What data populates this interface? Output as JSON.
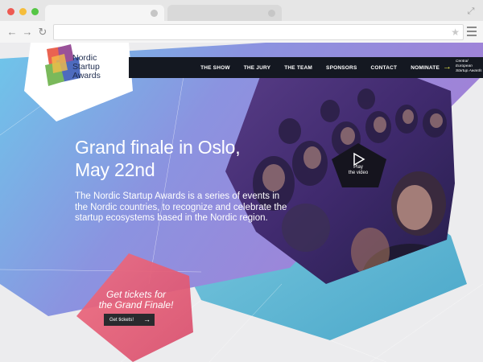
{
  "browser": {
    "icons": {
      "back": "back-arrow-icon",
      "forward": "forward-arrow-icon",
      "reload": "reload-icon",
      "bookmark": "star-icon",
      "menu": "hamburger-menu-icon",
      "fullscreen": "expand-icon"
    },
    "dot_colors": [
      "#ee5a52",
      "#f5bd3b",
      "#55c645"
    ]
  },
  "site": {
    "logo": {
      "text": "Nordic\nStartup\nAwards"
    },
    "nav": {
      "items": [
        "THE SHOW",
        "THE JURY",
        "THE TEAM",
        "SPONSORS",
        "CONTACT",
        "NOMINATE"
      ],
      "nominate_note": "Central\nEuropean\nStartup Awards"
    },
    "hero": {
      "title": "Grand finale in Oslo,\nMay 22nd",
      "description": "The Nordic Startup Awards is a series of events in the Nordic countries, to recognize and celebrate the startup ecosystems based in the Nordic region."
    },
    "video": {
      "label": "Play\nthe video"
    },
    "tickets": {
      "heading": "Get tickets for\nthe Grand Finale!",
      "button_label": "Get tickets!"
    },
    "colors": {
      "nav_bg": "#141821",
      "hero_blue": "#6aa8e0",
      "hero_purple": "#8d7fd8",
      "tickets_pink": "#e9607a",
      "logo_text": "#1d2b4e",
      "accent_yellow": "#e8e84a"
    }
  }
}
